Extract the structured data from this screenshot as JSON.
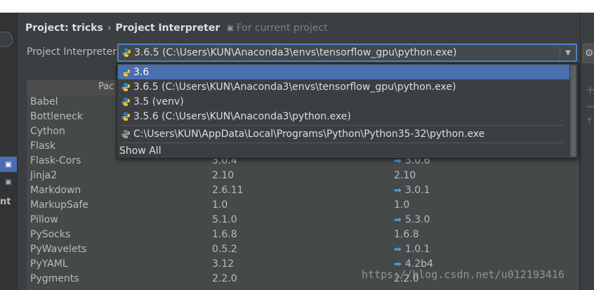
{
  "breadcrumb": {
    "project": "Project: tricks",
    "separator": "›",
    "page": "Project Interpreter",
    "scope_icon": "copy-icon",
    "scope": "For current project"
  },
  "interpreter": {
    "label": "Project Interpreter:",
    "selected": "3.6.5 (C:\\Users\\KUN\\Anaconda3\\envs\\tensorflow_gpu\\python.exe)"
  },
  "dropdown": {
    "items": [
      "3.6",
      "3.6.5 (C:\\Users\\KUN\\Anaconda3\\envs\\tensorflow_gpu\\python.exe)",
      "3.5 (venv)",
      "3.5.6 (C:\\Users\\KUN\\Anaconda3\\python.exe)",
      "C:\\Users\\KUN\\AppData\\Local\\Programs\\Python\\Python35-32\\python.exe"
    ],
    "show_all": "Show All"
  },
  "table": {
    "header_package": "Pac",
    "rows": [
      {
        "package": "Babel",
        "version": "",
        "latest": "",
        "upgrade": false
      },
      {
        "package": "Bottleneck",
        "version": "",
        "latest": "",
        "upgrade": false
      },
      {
        "package": "Cython",
        "version": "",
        "latest": "",
        "upgrade": false
      },
      {
        "package": "Flask",
        "version": "",
        "latest": "",
        "upgrade": false
      },
      {
        "package": "Flask-Cors",
        "version": "3.0.4",
        "latest": "3.0.6",
        "upgrade": true
      },
      {
        "package": "Jinja2",
        "version": "2.10",
        "latest": "2.10",
        "upgrade": false
      },
      {
        "package": "Markdown",
        "version": "2.6.11",
        "latest": "3.0.1",
        "upgrade": true
      },
      {
        "package": "MarkupSafe",
        "version": "1.0",
        "latest": "1.0",
        "upgrade": false
      },
      {
        "package": "Pillow",
        "version": "5.1.0",
        "latest": "5.3.0",
        "upgrade": true
      },
      {
        "package": "PySocks",
        "version": "1.6.8",
        "latest": "1.6.8",
        "upgrade": false
      },
      {
        "package": "PyWavelets",
        "version": "0.5.2",
        "latest": "1.0.1",
        "upgrade": true
      },
      {
        "package": "PyYAML",
        "version": "3.12",
        "latest": "4.2b4",
        "upgrade": true
      },
      {
        "package": "Pygments",
        "version": "2.2.0",
        "latest": "2.2.0",
        "upgrade": false
      }
    ]
  },
  "left_panel": {
    "partial_label": "nt"
  },
  "right_tools": {
    "add": "+",
    "remove": "−",
    "upgrade": "↑",
    "gear_icon": "gear-icon"
  },
  "watermark": "https://blog.csdn.net/u012193416",
  "colors": {
    "background": "#3c3f41",
    "selection": "#4b6eaf",
    "focus_border": "#4e83c9",
    "upgrade_arrow": "#4a9fe8"
  }
}
